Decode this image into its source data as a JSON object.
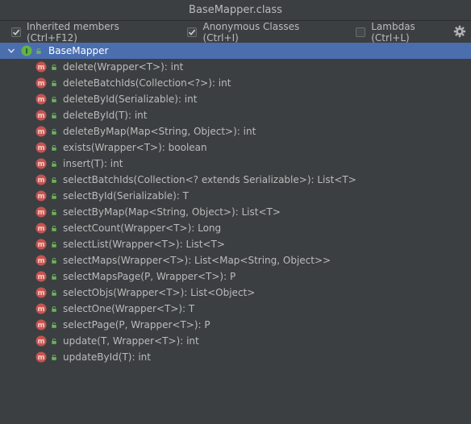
{
  "window": {
    "title": "BaseMapper.class"
  },
  "toolbar": {
    "options": [
      {
        "label": "Inherited members (Ctrl+F12)",
        "checked": true
      },
      {
        "label": "Anonymous Classes (Ctrl+I)",
        "checked": true
      },
      {
        "label": "Lambdas (Ctrl+L)",
        "checked": false
      }
    ],
    "settings_icon": "gear-icon"
  },
  "tree": {
    "root": {
      "label": "BaseMapper",
      "icon": "interface-icon",
      "expanded": true
    },
    "members": [
      {
        "label": "delete(Wrapper<T>): int"
      },
      {
        "label": "deleteBatchIds(Collection<?>): int"
      },
      {
        "label": "deleteById(Serializable): int"
      },
      {
        "label": "deleteById(T): int"
      },
      {
        "label": "deleteByMap(Map<String, Object>): int"
      },
      {
        "label": "exists(Wrapper<T>): boolean"
      },
      {
        "label": "insert(T): int"
      },
      {
        "label": "selectBatchIds(Collection<? extends Serializable>): List<T>"
      },
      {
        "label": "selectById(Serializable): T"
      },
      {
        "label": "selectByMap(Map<String, Object>): List<T>"
      },
      {
        "label": "selectCount(Wrapper<T>): Long"
      },
      {
        "label": "selectList(Wrapper<T>): List<T>"
      },
      {
        "label": "selectMaps(Wrapper<T>): List<Map<String, Object>>"
      },
      {
        "label": "selectMapsPage(P, Wrapper<T>): P"
      },
      {
        "label": "selectObjs(Wrapper<T>): List<Object>"
      },
      {
        "label": "selectOne(Wrapper<T>): T"
      },
      {
        "label": "selectPage(P, Wrapper<T>): P"
      },
      {
        "label": "update(T, Wrapper<T>): int"
      },
      {
        "label": "updateById(T): int"
      }
    ],
    "method_icon": "method-icon",
    "visibility_icon": "public-lock-icon"
  },
  "colors": {
    "background": "#3c3f41",
    "selection": "#4b6eaf",
    "method_badge": "#c75450",
    "interface_badge": "#62b543",
    "lock": "#6bb35b"
  }
}
